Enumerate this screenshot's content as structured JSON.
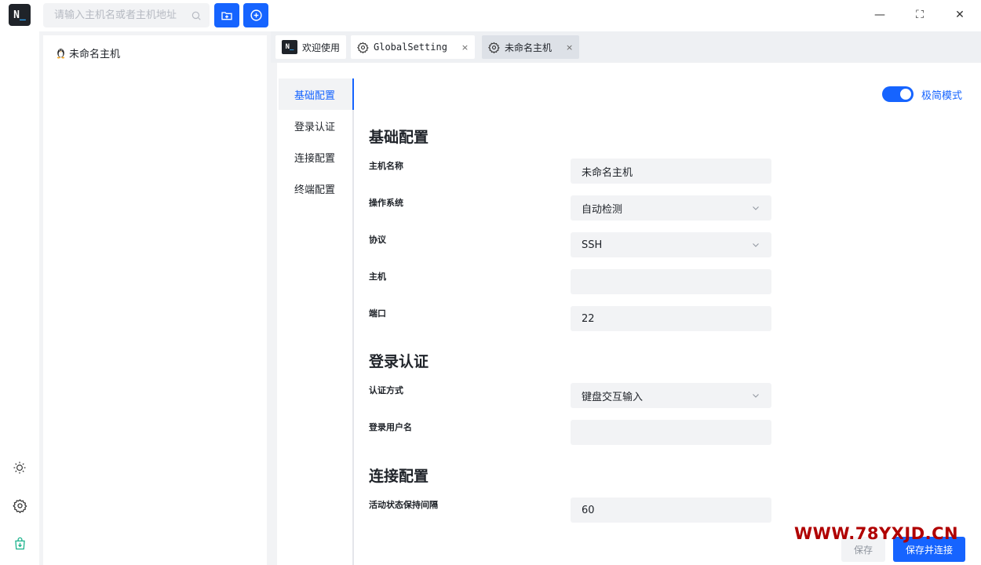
{
  "app": {
    "logo_text": "N",
    "logo_cursor": "_",
    "accent_color": "#1664ff"
  },
  "search": {
    "placeholder": "请输入主机名或者主机地址",
    "value": ""
  },
  "toolbar": {
    "new_folder_icon": "folder-plus-icon",
    "add_icon": "plus-circle-icon"
  },
  "window_controls": {
    "minimize": "—",
    "maximize": "⛶",
    "close": "✕"
  },
  "rail": {
    "icons": [
      "sun-icon",
      "gear-icon",
      "bag-download-icon"
    ]
  },
  "tree": {
    "items": [
      {
        "label": "未命名主机",
        "icon": "linux-penguin-icon"
      }
    ]
  },
  "tabs": [
    {
      "label": "欢迎使用",
      "icon": "app-logo-icon"
    },
    {
      "label": "GlobalSetting",
      "icon": "gear-icon",
      "close": "×"
    },
    {
      "label": "未命名主机",
      "icon": "gear-icon",
      "close": "×",
      "active": true
    }
  ],
  "subnav": {
    "items": [
      "基础配置",
      "登录认证",
      "连接配置",
      "终端配置"
    ],
    "active": "基础配置"
  },
  "simple_mode": {
    "label": "极简模式",
    "on": true
  },
  "sections": {
    "basic": {
      "title": "基础配置",
      "fields": {
        "host_name": {
          "label": "主机名称",
          "value": "未命名主机"
        },
        "os": {
          "label": "操作系统",
          "value": "自动检测"
        },
        "protocol": {
          "label": "协议",
          "value": "SSH"
        },
        "host": {
          "label": "主机",
          "value": ""
        },
        "port": {
          "label": "端口",
          "value": "22"
        }
      }
    },
    "auth": {
      "title": "登录认证",
      "fields": {
        "method": {
          "label": "认证方式",
          "value": "键盘交互输入"
        },
        "username": {
          "label": "登录用户名",
          "value": ""
        }
      }
    },
    "connection": {
      "title": "连接配置",
      "fields": {
        "keepalive": {
          "label": "活动状态保持间隔",
          "value": "60"
        }
      }
    }
  },
  "footer": {
    "save_label": "保存",
    "save_connect_label": "保存并连接"
  },
  "watermark": {
    "text": "WWW.78YXJD.CN"
  }
}
